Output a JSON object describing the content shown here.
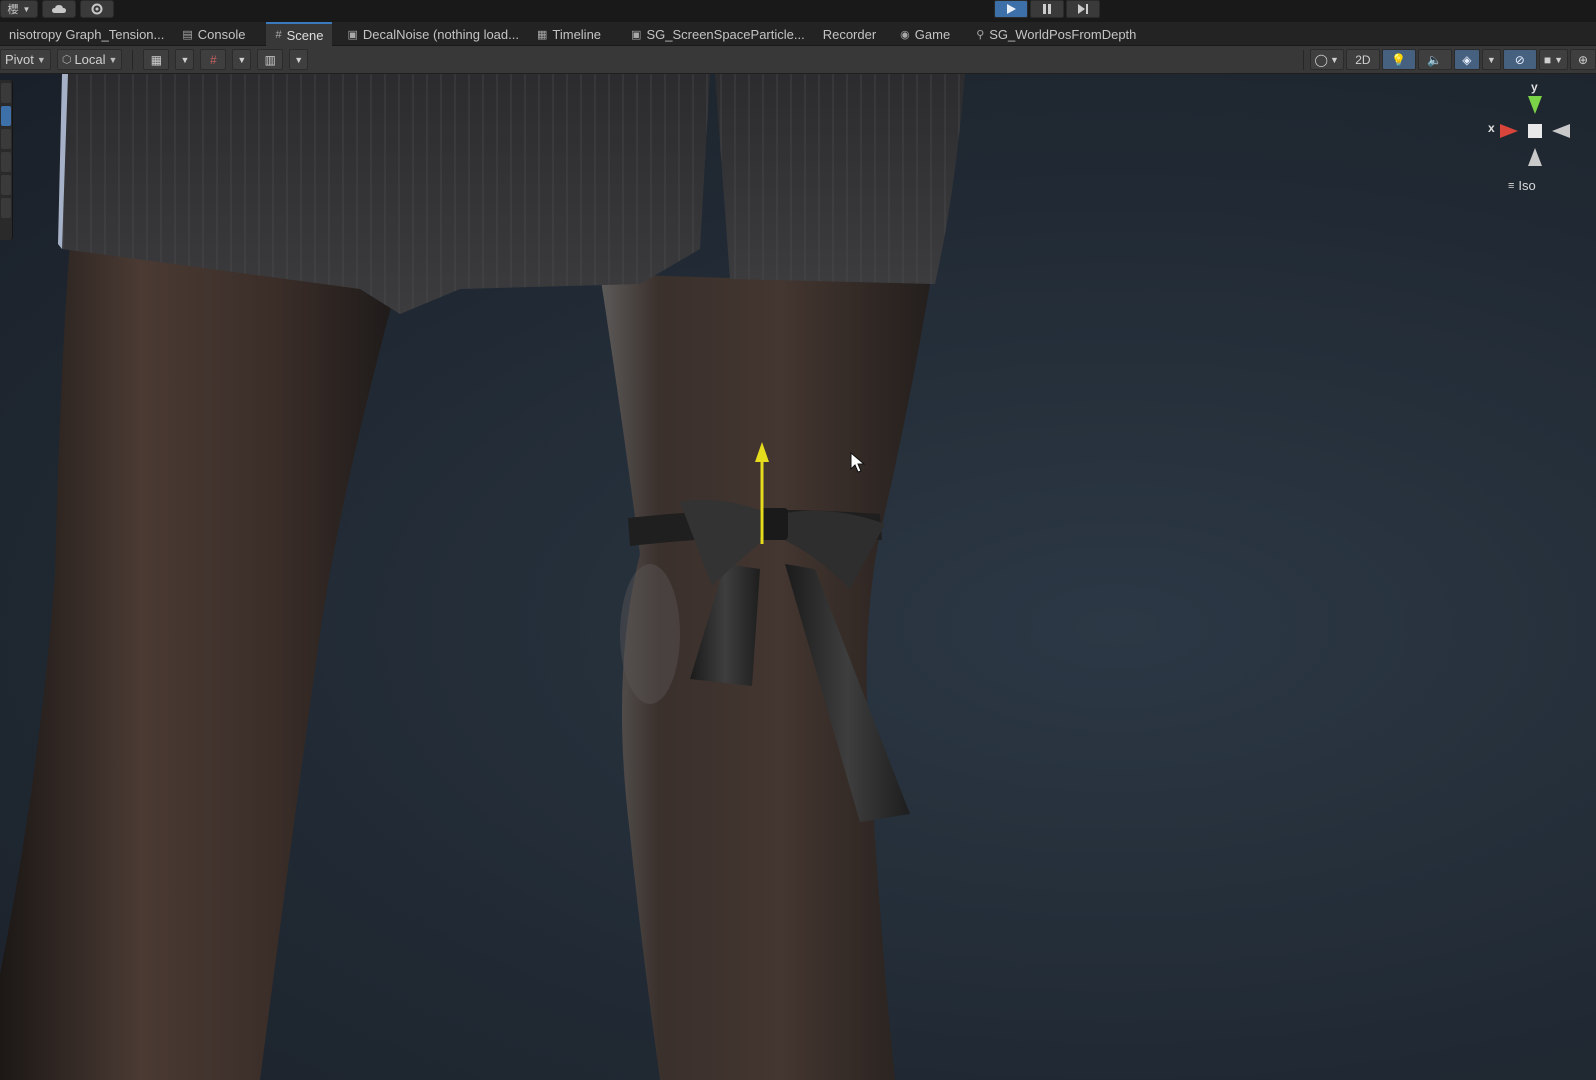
{
  "playbar": {
    "menu_glyph": "櫻",
    "cloud_icon": "cloud-icon",
    "settings_icon": "gear-icon",
    "play_icon": "play-icon",
    "pause_icon": "pause-icon",
    "step_icon": "step-icon"
  },
  "tabs": [
    {
      "label": "nisotropy Graph_Tension...",
      "icon": ""
    },
    {
      "label": "Console",
      "icon": "console-icon"
    },
    {
      "label": "Scene",
      "icon": "scene-icon"
    },
    {
      "label": "DecalNoise (nothing load...",
      "icon": "graph-icon"
    },
    {
      "label": "Timeline",
      "icon": "timeline-icon"
    },
    {
      "label": "SG_ScreenSpaceParticle...",
      "icon": "graph-icon"
    },
    {
      "label": "Recorder",
      "icon": ""
    },
    {
      "label": "Game",
      "icon": "gamepad-icon"
    },
    {
      "label": "SG_WorldPosFromDepth",
      "icon": "graph-icon"
    }
  ],
  "active_tab": "Scene",
  "scene_toolbar": {
    "pivot_label": "Pivot",
    "space_label": "Local",
    "mode_2d_label": "2D"
  },
  "viewport": {
    "gizmo_x_label": "x",
    "gizmo_y_label": "y",
    "projection_label": "Iso"
  },
  "colors": {
    "accent": "#3a79bb",
    "active_button": "#3d6fa8",
    "gizmo_x": "#d9453a",
    "gizmo_y": "#7bd348",
    "move_handle": "#e6dc1e"
  }
}
